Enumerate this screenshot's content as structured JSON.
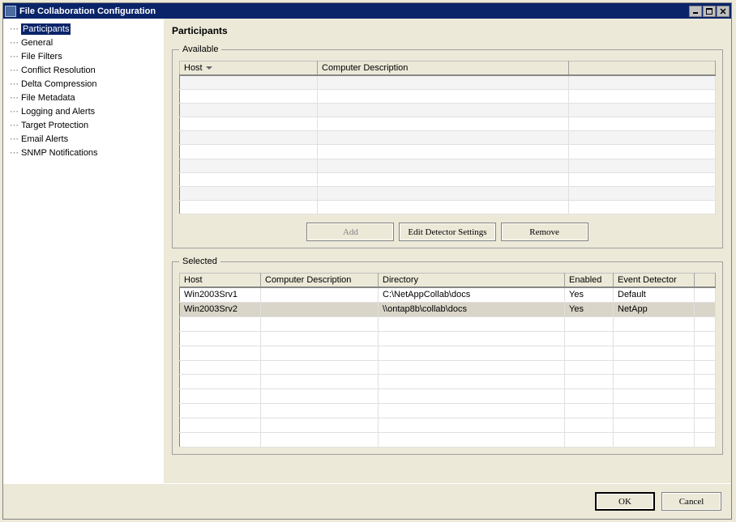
{
  "window": {
    "title": "File Collaboration Configuration"
  },
  "tree": {
    "items": [
      "Participants",
      "General",
      "File Filters",
      "Conflict Resolution",
      "Delta Compression",
      "File Metadata",
      "Logging and Alerts",
      "Target Protection",
      "Email Alerts",
      "SNMP Notifications"
    ],
    "selected_index": 0
  },
  "page": {
    "title": "Participants"
  },
  "available": {
    "legend": "Available",
    "columns": {
      "host": "Host",
      "desc": "Computer Description"
    },
    "rows_empty_count": 10,
    "buttons": {
      "add": "Add",
      "edit": "Edit Detector Settings",
      "remove": "Remove"
    },
    "add_disabled": true
  },
  "selected": {
    "legend": "Selected",
    "columns": {
      "host": "Host",
      "desc": "Computer Description",
      "dir": "Directory",
      "enabled": "Enabled",
      "detector": "Event Detector"
    },
    "rows": [
      {
        "host": "Win2003Srv1",
        "desc": "",
        "dir": "C:\\NetAppCollab\\docs",
        "enabled": "Yes",
        "detector": "Default",
        "selected": false
      },
      {
        "host": "Win2003Srv2",
        "desc": "",
        "dir": "\\\\ontap8b\\collab\\docs",
        "enabled": "Yes",
        "detector": "NetApp",
        "selected": true
      }
    ],
    "empty_rows": 9
  },
  "footer": {
    "ok": "OK",
    "cancel": "Cancel"
  }
}
